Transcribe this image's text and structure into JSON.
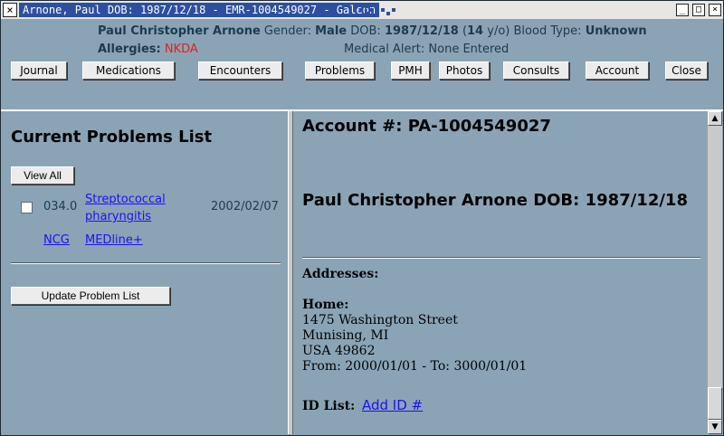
{
  "window": {
    "title": "Arnone, Paul DOB: 1987/12/18 - EMR-1004549027 - Galeon",
    "close_glyph": "×",
    "min_glyph": "_",
    "max_glyph": "□",
    "x_glyph": "×"
  },
  "patient": {
    "name": "Paul Christopher Arnone",
    "gender_label": "Gender:",
    "gender": "Male",
    "dob_label": "DOB:",
    "dob": "1987/12/18",
    "age_open": "(",
    "age": "14",
    "age_unit": "y/o)",
    "blood_label": "Blood Type:",
    "blood_type": "Unknown",
    "allergies_label": "Allergies:",
    "allergies": "NKDA",
    "alert_label": "Medical Alert:",
    "alert": "None Entered"
  },
  "nav": {
    "journal": "Journal",
    "medications": "Medications",
    "encounters": "Encounters",
    "problems": "Problems",
    "pmh": "PMH",
    "photos": "Photos",
    "consults": "Consults",
    "account": "Account",
    "close": "Close"
  },
  "problems": {
    "title": "Current Problems List",
    "view_all": "View All",
    "items": [
      {
        "code": "034.0",
        "name": "Streptococcal pharyngitis",
        "date": "2002/02/07"
      }
    ],
    "links": {
      "ncg": "NCG",
      "medline": "MEDline+"
    },
    "update_button": "Update Problem List"
  },
  "account": {
    "label": "Account #:",
    "number": "PA-1004549027",
    "name_dob": "Paul Christopher Arnone DOB: 1987/12/18",
    "addresses_label": "Addresses:",
    "home_label": "Home:",
    "street": "1475 Washington Street",
    "city": "Munising, MI",
    "country_zip": "USA 49862",
    "period": "From: 2000/01/01 - To: 3000/01/01",
    "id_label": "ID List:",
    "add_id": "Add ID #"
  },
  "scroll": {
    "up": "▲",
    "down": "▼"
  }
}
